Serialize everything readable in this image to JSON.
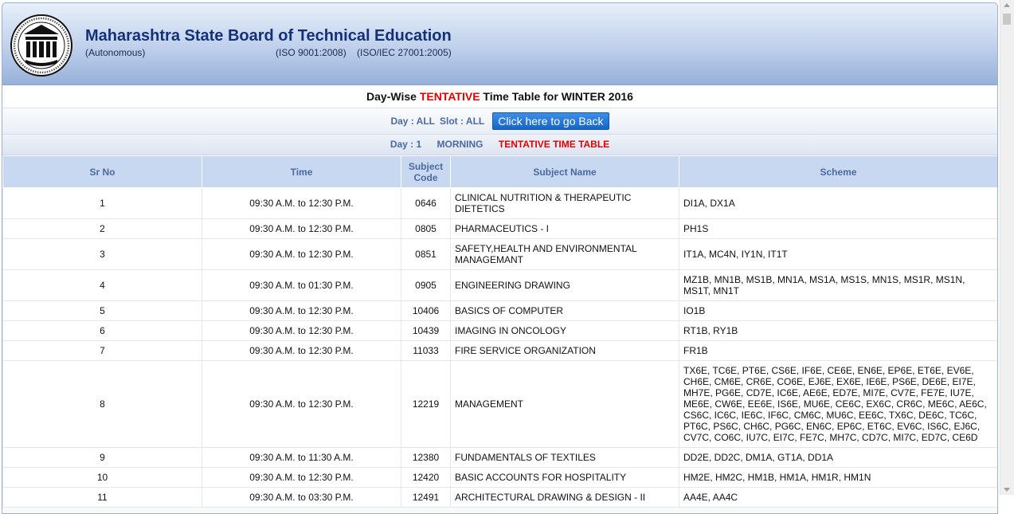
{
  "header": {
    "title": "Maharashtra State Board of Technical Education",
    "autonomous": "(Autonomous)",
    "iso1": "(ISO 9001:2008)",
    "iso2": "(ISO/IEC 27001:2005)",
    "logo_icon": "msbte-seal-logo"
  },
  "page_title": {
    "prefix": "Day-Wise ",
    "highlight": "TENTATIVE",
    "suffix": " Time Table for WINTER 2016"
  },
  "filter": {
    "day": "Day : ALL",
    "slot": "Slot : ALL",
    "back_label": "Click here to go Back"
  },
  "day_info": {
    "day": "Day : 1",
    "session": "MORNING",
    "tag": "TENTATIVE TIME TABLE"
  },
  "colors": {
    "accent_red": "#e00000",
    "header_blue": "#12317a",
    "button_blue": "#1566c9"
  },
  "table": {
    "headers": [
      "Sr No",
      "Time",
      "Subject Code",
      "Subject Name",
      "Scheme"
    ],
    "rows": [
      {
        "sr": "1",
        "time": "09:30 A.M. to 12:30 P.M.",
        "code": "0646",
        "name": "CLINICAL NUTRITION & THERAPEUTIC DIETETICS",
        "scheme": "DI1A, DX1A"
      },
      {
        "sr": "2",
        "time": "09:30 A.M. to 12:30 P.M.",
        "code": "0805",
        "name": "PHARMACEUTICS - I",
        "scheme": "PH1S"
      },
      {
        "sr": "3",
        "time": "09:30 A.M. to 12:30 P.M.",
        "code": "0851",
        "name": "SAFETY,HEALTH AND ENVIRONMENTAL MANAGEMANT",
        "scheme": "IT1A, MC4N, IY1N, IT1T"
      },
      {
        "sr": "4",
        "time": "09:30 A.M. to 01:30 P.M.",
        "code": "0905",
        "name": "ENGINEERING DRAWING",
        "scheme": "MZ1B, MN1B, MS1B, MN1A, MS1A, MS1S, MN1S, MS1R, MS1N, MS1T, MN1T"
      },
      {
        "sr": "5",
        "time": "09:30 A.M. to 12:30 P.M.",
        "code": "10406",
        "name": "BASICS OF COMPUTER",
        "scheme": "IO1B"
      },
      {
        "sr": "6",
        "time": "09:30 A.M. to 12:30 P.M.",
        "code": "10439",
        "name": "IMAGING IN ONCOLOGY",
        "scheme": "RT1B, RY1B"
      },
      {
        "sr": "7",
        "time": "09:30 A.M. to 12:30 P.M.",
        "code": "11033",
        "name": "FIRE SERVICE ORGANIZATION",
        "scheme": "FR1B"
      },
      {
        "sr": "8",
        "time": "09:30 A.M. to 12:30 P.M.",
        "code": "12219",
        "name": "MANAGEMENT",
        "scheme": "TX6E, TC6E, PT6E, CS6E, IF6E, CE6E, EN6E, EP6E, ET6E, EV6E, CH6E, CM6E, CR6E, CO6E, EJ6E, EX6E, IE6E, PS6E, DE6E, EI7E, MH7E, PG6E, CD7E, IC6E, AE6E, ED7E, MI7E, CV7E, FE7E, IU7E, ME6E, CW6E, EE6E, IS6E, MU6E, CE6C, EX6C, CR6C, ME6C, AE6C, CS6C, IC6C, IE6C, IF6C, CM6C, MU6C, EE6C, TX6C, DE6C, TC6C, PT6C, PS6C, CH6C, PG6C, EN6C, EP6C, ET6C, EV6C, IS6C, EJ6C, CV7C, CO6C, IU7C, EI7C, FE7C, MH7C, CD7C, MI7C, ED7C, CE6D"
      },
      {
        "sr": "9",
        "time": "09:30 A.M. to 11:30 A.M.",
        "code": "12380",
        "name": "FUNDAMENTALS OF TEXTILES",
        "scheme": "DD2E, DD2C, DM1A, GT1A, DD1A"
      },
      {
        "sr": "10",
        "time": "09:30 A.M. to 12:30 P.M.",
        "code": "12420",
        "name": "BASIC ACCOUNTS FOR HOSPITALITY",
        "scheme": "HM2E, HM2C, HM1B, HM1A, HM1R, HM1N"
      },
      {
        "sr": "11",
        "time": "09:30 A.M. to 03:30 P.M.",
        "code": "12491",
        "name": "ARCHITECTURAL DRAWING & DESIGN - II",
        "scheme": "AA4E, AA4C"
      }
    ]
  }
}
